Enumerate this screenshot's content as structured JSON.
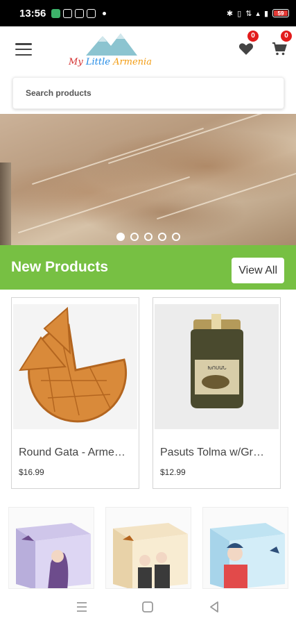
{
  "status_bar": {
    "time": "13:56",
    "battery": "59"
  },
  "header": {
    "logo_words": [
      "My",
      "Little",
      "Armenia"
    ],
    "wishlist_count": "0",
    "cart_count": "0"
  },
  "search": {
    "placeholder": "Search products",
    "value": ""
  },
  "banner": {
    "slide_count": 5,
    "active_slide": 0
  },
  "new_products": {
    "title": "New Products",
    "view_all_label": "View All",
    "items": [
      {
        "name": "Round Gata - Arme…",
        "price": "$16.99"
      },
      {
        "name": "Pasuts Tolma w/Gr…",
        "price": "$12.99"
      }
    ],
    "jar_label": "ԽՈՍԱՆ"
  },
  "colors": {
    "accent_green": "#77c043",
    "badge_red": "#e21b1b"
  }
}
